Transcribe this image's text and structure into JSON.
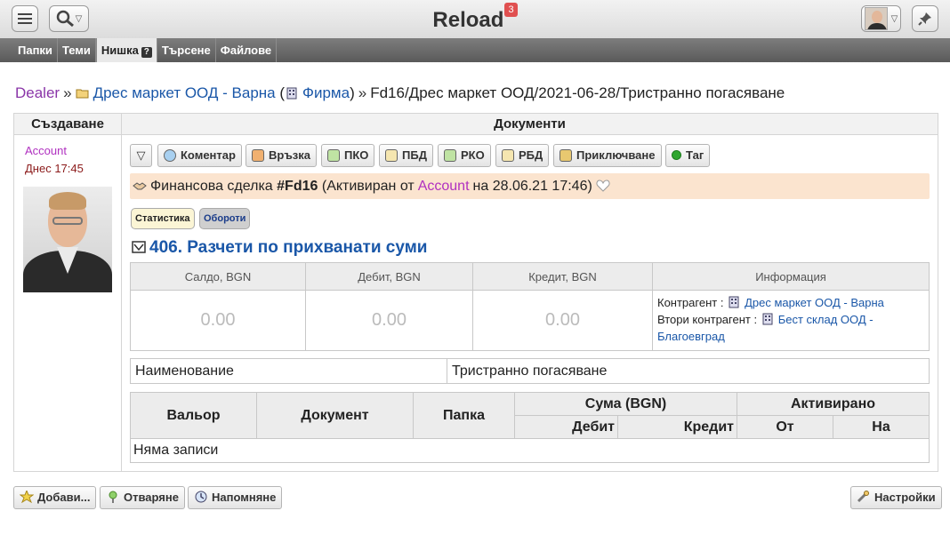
{
  "header": {
    "title": "Reload",
    "notifications": "3"
  },
  "nav": {
    "tabs": [
      "Папки",
      "Теми",
      "Нишка",
      "Търсене",
      "Файлове"
    ],
    "help": "?"
  },
  "breadcrumb": {
    "dealer": "Dealer",
    "company": "Дрес маркет ООД - Варна",
    "firm": "Фирма",
    "path": "Fd16/Дрес маркет ООД/2021-06-28/Тристранно погасяване"
  },
  "columns": {
    "created": "Създаване",
    "documents": "Документи"
  },
  "author": {
    "name": "Account",
    "date": "Днес 17:45"
  },
  "toolbar": {
    "comment": "Коментар",
    "link": "Връзка",
    "pko": "ПКО",
    "pbd": "ПБД",
    "rko": "РКО",
    "rbd": "РБД",
    "close": "Приключване",
    "tag": "Таг"
  },
  "deal": {
    "prefix": "Финансова сделка",
    "number": "#Fd16",
    "activated_by": "(Активиран от",
    "account": "Account",
    "activated_on": "на 28.06.21 17:46)"
  },
  "pills": {
    "stats": "Статистика",
    "turnover": "Обороти"
  },
  "section": {
    "title": "406. Разчети по прихванати суми"
  },
  "summary": {
    "headers": [
      "Салдо, BGN",
      "Дебит, BGN",
      "Кредит, BGN",
      "Информация"
    ],
    "values": [
      "0.00",
      "0.00",
      "0.00"
    ],
    "contractor_label": "Контрагент :",
    "contractor": "Дрес маркет ООД - Варна",
    "second_label": "Втори контрагент :",
    "second": "Бест склад ООД - Благоевград"
  },
  "name_row": {
    "label": "Наименование",
    "value": "Тристранно погасяване"
  },
  "rows_table": {
    "currency": "Вальор",
    "document": "Документ",
    "folder": "Папка",
    "amount": "Сума (BGN)",
    "activated": "Активирано",
    "debit": "Дебит",
    "credit": "Кредит",
    "from": "От",
    "to": "На",
    "empty": "Няма записи"
  },
  "footer": {
    "add": "Добави...",
    "open": "Отваряне",
    "remind": "Напомняне",
    "settings": "Настройки"
  }
}
